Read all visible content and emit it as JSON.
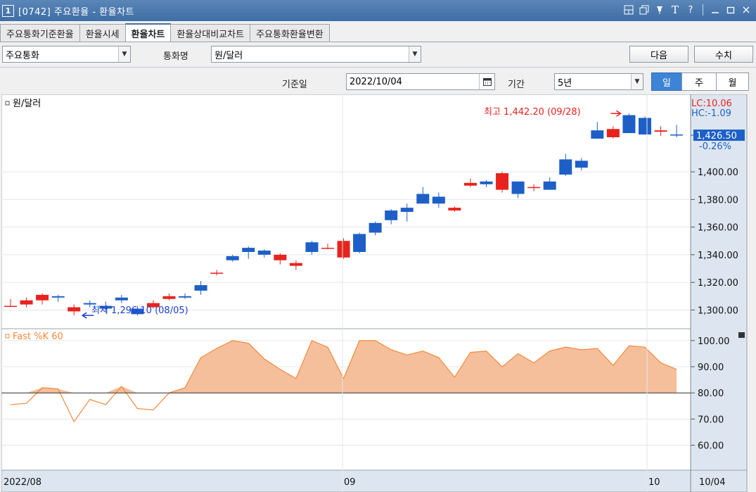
{
  "window": {
    "number": "1",
    "title": "[0742] 주요환율 - 환율차트"
  },
  "tabs": [
    {
      "label": "주요통화기준환율",
      "active": false
    },
    {
      "label": "환율시세",
      "active": false
    },
    {
      "label": "환율차트",
      "active": true
    },
    {
      "label": "환율상대비교차트",
      "active": false
    },
    {
      "label": "주요통화환율변환",
      "active": false
    }
  ],
  "controls": {
    "category": "주요통화",
    "currency_label": "통화명",
    "currency_value": "원/달러",
    "next_button": "다음",
    "edit_button": "수치",
    "date_label": "기준일",
    "date_value": "2022/10/04",
    "period_label": "기간",
    "period_value": "5년",
    "unit_day": "일",
    "unit_week": "주",
    "unit_month": "월"
  },
  "colors": {
    "up": "#e8231d",
    "down": "#1d5fc7",
    "fill": "#f5bf9c",
    "line": "#f28a3c",
    "accent": "#3d84d6"
  },
  "chart_data": [
    {
      "type": "candlestick",
      "title": "원/달러",
      "y_ticks": [
        "1,400.00",
        "1,380.00",
        "1,360.00",
        "1,340.00",
        "1,320.00",
        "1,300.00"
      ],
      "ylim": [
        1288,
        1452
      ],
      "lc_label": "LC:10.06",
      "hc_label": "HC:-1.09",
      "last_price": "1,426.50",
      "last_change": "-0.26%",
      "last_value": 1426.5,
      "max_label": "최고 1,442.20 (09/28)",
      "min_label": "최저 1,296.10 (08/05)",
      "max_index": 39,
      "min_index": 4,
      "x_labels": [
        "2022/08",
        "09",
        "10",
        "10/04"
      ],
      "candles": [
        {
          "o": 1303,
          "h": 1308,
          "l": 1303,
          "c": 1303
        },
        {
          "o": 1304,
          "h": 1309,
          "l": 1302,
          "c": 1307
        },
        {
          "o": 1307,
          "h": 1312,
          "l": 1304,
          "c": 1311
        },
        {
          "o": 1310,
          "h": 1311,
          "l": 1306,
          "c": 1309
        },
        {
          "o": 1299,
          "h": 1304,
          "l": 1296.1,
          "c": 1302
        },
        {
          "o": 1305,
          "h": 1307,
          "l": 1302,
          "c": 1304
        },
        {
          "o": 1303,
          "h": 1306,
          "l": 1298,
          "c": 1301
        },
        {
          "o": 1309,
          "h": 1311,
          "l": 1305,
          "c": 1307
        },
        {
          "o": 1301,
          "h": 1303,
          "l": 1296,
          "c": 1297
        },
        {
          "o": 1302,
          "h": 1307,
          "l": 1301,
          "c": 1305
        },
        {
          "o": 1308,
          "h": 1312,
          "l": 1307,
          "c": 1310
        },
        {
          "o": 1310,
          "h": 1312,
          "l": 1308,
          "c": 1309
        },
        {
          "o": 1318,
          "h": 1321,
          "l": 1311,
          "c": 1314
        },
        {
          "o": 1327,
          "h": 1329,
          "l": 1325,
          "c": 1327
        },
        {
          "o": 1339,
          "h": 1340,
          "l": 1335,
          "c": 1336
        },
        {
          "o": 1345,
          "h": 1346,
          "l": 1337,
          "c": 1342
        },
        {
          "o": 1343,
          "h": 1344,
          "l": 1338,
          "c": 1340
        },
        {
          "o": 1336,
          "h": 1341,
          "l": 1333,
          "c": 1340
        },
        {
          "o": 1332,
          "h": 1336,
          "l": 1329,
          "c": 1334
        },
        {
          "o": 1349,
          "h": 1350,
          "l": 1340,
          "c": 1342
        },
        {
          "o": 1345,
          "h": 1348,
          "l": 1344,
          "c": 1345
        },
        {
          "o": 1338,
          "h": 1352,
          "l": 1337,
          "c": 1350
        },
        {
          "o": 1355,
          "h": 1356,
          "l": 1341,
          "c": 1342
        },
        {
          "o": 1363,
          "h": 1364,
          "l": 1354,
          "c": 1356
        },
        {
          "o": 1372,
          "h": 1373,
          "l": 1362,
          "c": 1365
        },
        {
          "o": 1374,
          "h": 1377,
          "l": 1364,
          "c": 1371
        },
        {
          "o": 1384,
          "h": 1389,
          "l": 1377,
          "c": 1377
        },
        {
          "o": 1382,
          "h": 1385,
          "l": 1374,
          "c": 1377
        },
        {
          "o": 1372,
          "h": 1375,
          "l": 1371,
          "c": 1374
        },
        {
          "o": 1390,
          "h": 1395,
          "l": 1389,
          "c": 1392
        },
        {
          "o": 1393,
          "h": 1394,
          "l": 1389,
          "c": 1391
        },
        {
          "o": 1387,
          "h": 1400,
          "l": 1385,
          "c": 1399
        },
        {
          "o": 1393,
          "h": 1393,
          "l": 1381,
          "c": 1384
        },
        {
          "o": 1389,
          "h": 1391,
          "l": 1386,
          "c": 1389
        },
        {
          "o": 1393,
          "h": 1396,
          "l": 1387,
          "c": 1387
        },
        {
          "o": 1409,
          "h": 1413,
          "l": 1397,
          "c": 1398
        },
        {
          "o": 1408,
          "h": 1410,
          "l": 1401,
          "c": 1403
        },
        {
          "o": 1430,
          "h": 1436,
          "l": 1424,
          "c": 1424
        },
        {
          "o": 1425,
          "h": 1433,
          "l": 1424,
          "c": 1431
        },
        {
          "o": 1441,
          "h": 1442.2,
          "l": 1428,
          "c": 1428
        },
        {
          "o": 1439,
          "h": 1440,
          "l": 1427,
          "c": 1427
        },
        {
          "o": 1429,
          "h": 1433,
          "l": 1426,
          "c": 1430
        },
        {
          "o": 1427,
          "h": 1434,
          "l": 1425,
          "c": 1426.5
        }
      ]
    },
    {
      "type": "area",
      "title": "Fast %K 60",
      "y_ticks": [
        "100.00",
        "90.00",
        "80.00",
        "70.00",
        "60.00"
      ],
      "ylim": [
        51,
        104
      ],
      "reference": 80,
      "values": [
        75.5,
        76,
        82,
        81.5,
        69,
        77.5,
        75.5,
        82.5,
        74,
        73.5,
        80,
        82,
        93.5,
        97,
        100,
        99,
        93,
        89,
        85.5,
        100,
        97.5,
        85.5,
        100,
        100,
        96.5,
        94.5,
        96,
        93.5,
        86,
        95.5,
        96,
        90,
        95,
        91.5,
        96,
        97.5,
        96.5,
        97,
        90.5,
        98,
        97.5,
        91.5,
        89
      ]
    }
  ]
}
